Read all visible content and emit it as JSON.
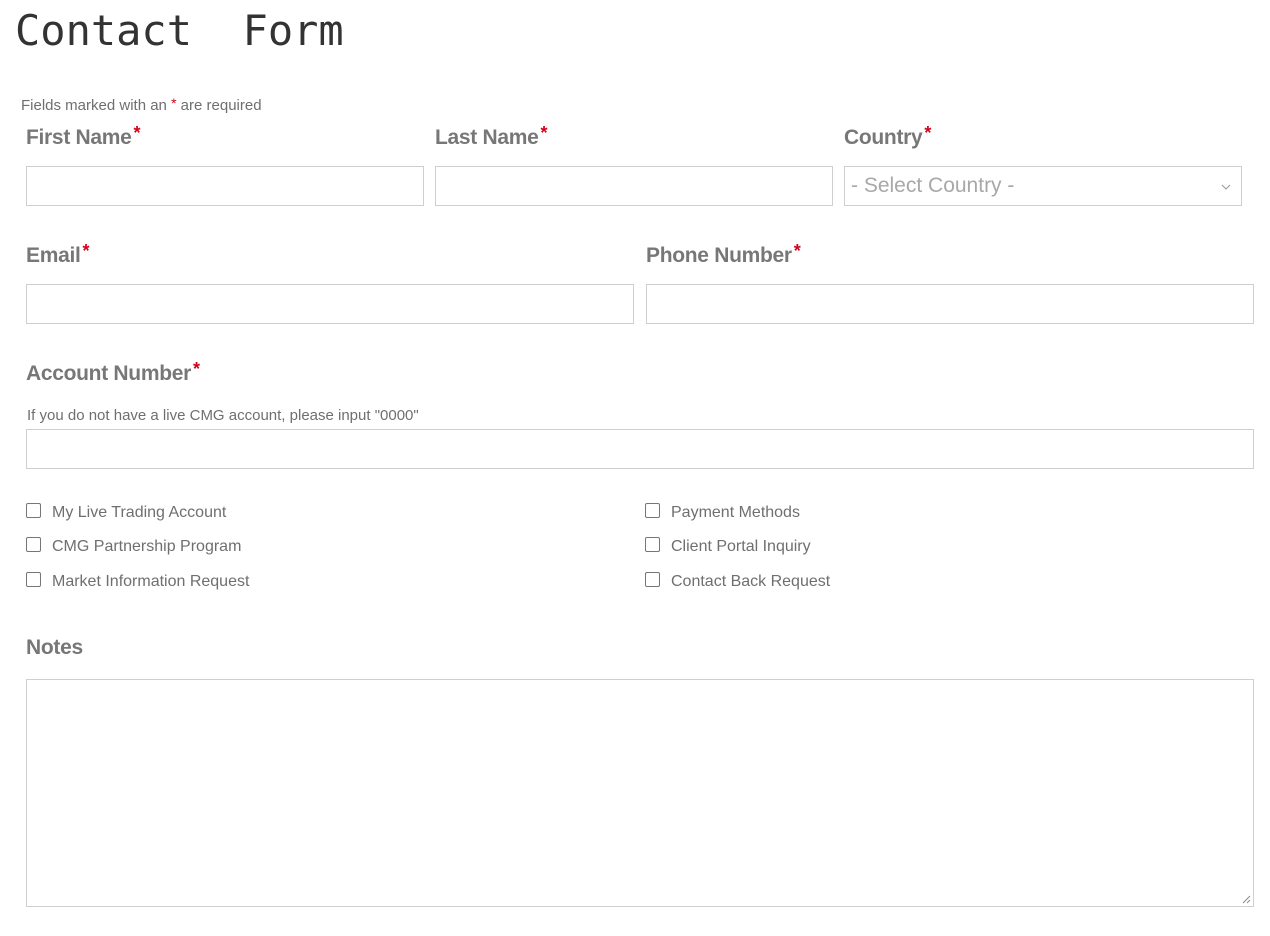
{
  "page": {
    "title": "Contact  Form",
    "required_note_prefix": "Fields marked with an ",
    "required_note_star": "*",
    "required_note_suffix": " are required"
  },
  "fields": {
    "first_name": {
      "label": "First Name",
      "star": "*",
      "value": ""
    },
    "last_name": {
      "label": "Last Name",
      "star": "*",
      "value": ""
    },
    "country": {
      "label": "Country",
      "star": "*",
      "selected": "- Select Country -"
    },
    "email": {
      "label": "Email",
      "star": "*",
      "value": ""
    },
    "phone": {
      "label": "Phone Number",
      "star": "*",
      "value": ""
    },
    "account_number": {
      "label": "Account Number",
      "star": "*",
      "help": "If you do not have a live CMG account, please input \"0000\"",
      "value": ""
    },
    "notes": {
      "label": "Notes",
      "value": ""
    }
  },
  "topics": {
    "left": [
      {
        "label": "My Live Trading Account",
        "checked": false
      },
      {
        "label": "CMG Partnership Program",
        "checked": false
      },
      {
        "label": "Market Information Request",
        "checked": false
      }
    ],
    "right": [
      {
        "label": "Payment Methods",
        "checked": false
      },
      {
        "label": "Client Portal Inquiry",
        "checked": false
      },
      {
        "label": "Contact Back Request",
        "checked": false
      }
    ]
  },
  "colors": {
    "required_star": "#d0021b",
    "label": "#777777",
    "border": "#cfcfcf",
    "placeholder": "#a8a8a8"
  },
  "icons": {
    "select_arrow": "chevron-down-icon",
    "textarea_resize": "resize-grip-icon"
  }
}
